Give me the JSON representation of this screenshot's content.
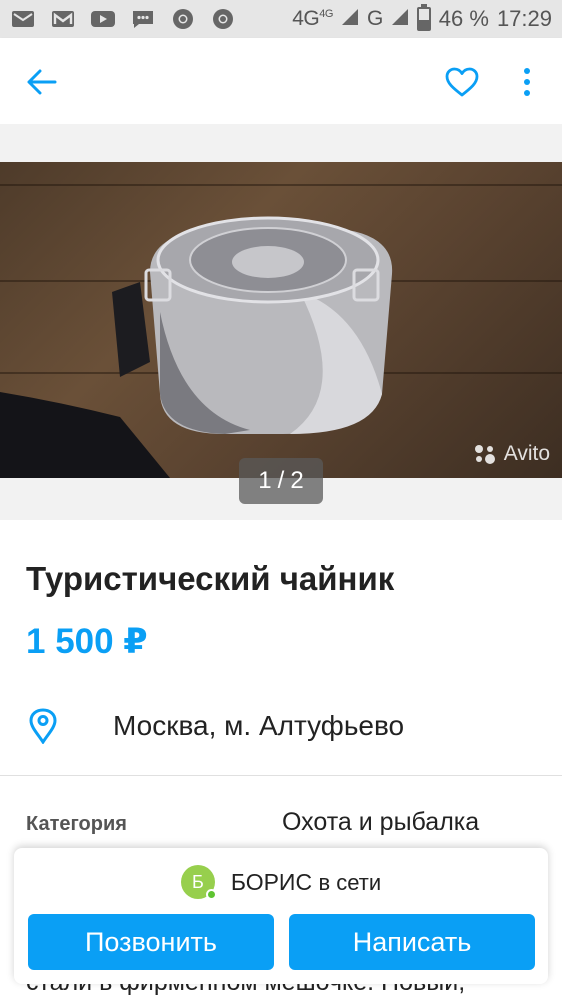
{
  "status_bar": {
    "network": "4G",
    "network_sup": "4G",
    "carrier": "G",
    "battery": "46 %",
    "battery_level": 0.46,
    "time": "17:29",
    "notification_icons": [
      "mail-icon",
      "gmail-icon",
      "youtube-icon",
      "sms-icon",
      "chrome-icon",
      "chrome-icon"
    ]
  },
  "listing": {
    "title": "Туристический чайник",
    "price": "1 500 ₽",
    "location": "Москва, м. Алтуфьево",
    "category_label": "Категория",
    "category_value": "Охота и рыбалка",
    "description_fragment": "стали в фирменном мешочке. Новый,"
  },
  "gallery": {
    "current": "1",
    "separator": "/",
    "total": "2",
    "watermark": "Avito"
  },
  "seller": {
    "initial": "Б",
    "name": "БОРИС",
    "status": "в сети"
  },
  "actions": {
    "call_label": "Позвонить",
    "write_label": "Написать"
  },
  "colors": {
    "accent": "#0a9ff5",
    "online": "#5fc431",
    "avatar": "#97cf4d"
  }
}
